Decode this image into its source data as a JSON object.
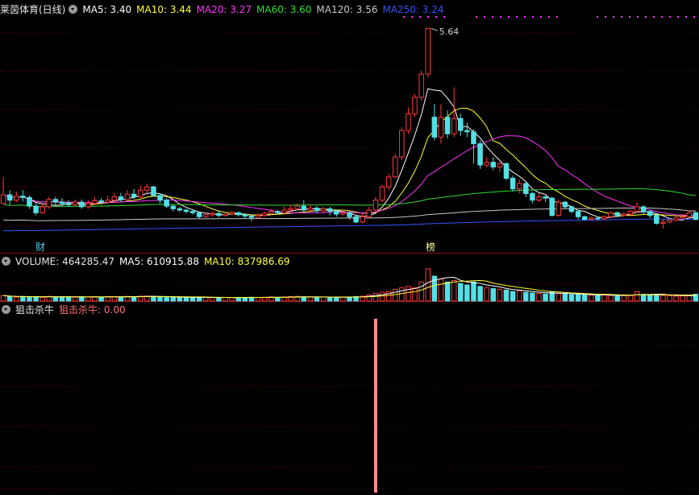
{
  "main_header": {
    "stock": "莱茵体育(日线)",
    "ma5_label": "MA5: 3.40",
    "ma10_label": "MA10: 3.44",
    "ma20_label": "MA20: 3.27",
    "ma60_label": "MA60: 3.60",
    "ma120_label": "MA120: 3.56",
    "ma250_label": "MA250: 3.24"
  },
  "peak_label": "5.64",
  "markers": {
    "cai": "财",
    "bang": "榜"
  },
  "volume_header": {
    "label": "VOLUME: 464285.47",
    "ma5": "MA5: 610915.88",
    "ma10": "MA10: 837986.69"
  },
  "indicator_header": {
    "name": "狙击杀牛",
    "value_label": "狙击杀牛: 0.00"
  },
  "colors": {
    "up": "#ff3a3a",
    "down": "#52e0e6",
    "ma5": "#ffffff",
    "ma10": "#ffff33",
    "ma20": "#ff33ff",
    "ma60": "#33dd33",
    "ma120": "#c8c8c8",
    "ma250": "#3355ff",
    "signal": "#ff8c8c"
  },
  "chart_data": {
    "type": "candlestick",
    "price_axis_range": [
      2.5,
      5.8
    ],
    "volume_axis_range": [
      0,
      2200000
    ],
    "indicator_axis_range": [
      0,
      1
    ],
    "signal_index": 57,
    "candles": [
      [
        3.0,
        3.13,
        3.4,
        3.0
      ],
      [
        3.13,
        3.05,
        3.2,
        2.98
      ],
      [
        3.05,
        3.11,
        3.18,
        3.02
      ],
      [
        3.11,
        3.09,
        3.2,
        3.03
      ],
      [
        3.09,
        2.96,
        3.12,
        2.92
      ],
      [
        2.96,
        2.86,
        3.0,
        2.82
      ],
      [
        2.86,
        2.95,
        3.0,
        2.84
      ],
      [
        2.95,
        3.06,
        3.1,
        2.92
      ],
      [
        3.06,
        3.02,
        3.1,
        2.98
      ],
      [
        3.02,
        3.0,
        3.08,
        2.96
      ],
      [
        3.0,
        2.98,
        3.05,
        2.95
      ],
      [
        2.98,
        3.02,
        3.06,
        2.95
      ],
      [
        3.02,
        2.95,
        3.06,
        2.92
      ],
      [
        2.95,
        3.0,
        3.05,
        2.92
      ],
      [
        3.0,
        3.04,
        3.1,
        2.98
      ],
      [
        3.04,
        3.02,
        3.08,
        2.98
      ],
      [
        3.02,
        3.05,
        3.12,
        3.0
      ],
      [
        3.05,
        3.1,
        3.15,
        3.02
      ],
      [
        3.1,
        3.06,
        3.16,
        3.03
      ],
      [
        3.06,
        3.14,
        3.2,
        3.04
      ],
      [
        3.14,
        3.1,
        3.22,
        3.07
      ],
      [
        3.1,
        3.2,
        3.27,
        3.08
      ],
      [
        3.2,
        3.25,
        3.3,
        3.15
      ],
      [
        3.25,
        3.12,
        3.27,
        3.1
      ],
      [
        3.12,
        3.05,
        3.15,
        3.0
      ],
      [
        3.05,
        2.96,
        3.08,
        2.93
      ],
      [
        2.96,
        2.92,
        2.98,
        2.88
      ],
      [
        2.92,
        2.9,
        2.95,
        2.87
      ],
      [
        2.9,
        2.88,
        2.92,
        2.85
      ],
      [
        2.88,
        2.86,
        2.9,
        2.83
      ],
      [
        2.86,
        2.8,
        2.88,
        2.77
      ],
      [
        2.8,
        2.83,
        2.86,
        2.78
      ],
      [
        2.83,
        2.85,
        2.88,
        2.8
      ],
      [
        2.85,
        2.82,
        2.88,
        2.79
      ],
      [
        2.82,
        2.84,
        2.87,
        2.8
      ],
      [
        2.84,
        2.86,
        2.89,
        2.82
      ],
      [
        2.86,
        2.83,
        2.88,
        2.8
      ],
      [
        2.83,
        2.81,
        2.86,
        2.78
      ],
      [
        2.81,
        2.79,
        2.83,
        2.73
      ],
      [
        2.79,
        2.82,
        2.85,
        2.77
      ],
      [
        2.82,
        2.85,
        2.88,
        2.8
      ],
      [
        2.85,
        2.88,
        2.92,
        2.82
      ],
      [
        2.88,
        2.86,
        2.9,
        2.83
      ],
      [
        2.86,
        2.9,
        2.95,
        2.84
      ],
      [
        2.9,
        2.92,
        2.98,
        2.88
      ],
      [
        2.92,
        2.96,
        3.0,
        2.9
      ],
      [
        2.96,
        2.9,
        3.05,
        2.87
      ],
      [
        2.9,
        2.93,
        2.98,
        2.88
      ],
      [
        2.93,
        2.89,
        2.96,
        2.85
      ],
      [
        2.89,
        2.92,
        2.95,
        2.85
      ],
      [
        2.92,
        2.88,
        2.95,
        2.82
      ],
      [
        2.88,
        2.84,
        2.91,
        2.8
      ],
      [
        2.84,
        2.86,
        2.9,
        2.82
      ],
      [
        2.86,
        2.8,
        2.88,
        2.76
      ],
      [
        2.8,
        2.72,
        2.82,
        2.7
      ],
      [
        2.72,
        2.8,
        2.85,
        2.7
      ],
      [
        2.8,
        2.9,
        2.95,
        2.78
      ],
      [
        2.9,
        3.05,
        3.1,
        2.88
      ],
      [
        3.05,
        3.25,
        3.28,
        3.02
      ],
      [
        3.25,
        3.4,
        3.45,
        3.2
      ],
      [
        3.4,
        3.7,
        3.75,
        3.38
      ],
      [
        3.7,
        4.1,
        4.15,
        3.65
      ],
      [
        4.1,
        4.35,
        4.45,
        4.05
      ],
      [
        4.35,
        4.6,
        4.65,
        4.3
      ],
      [
        4.6,
        4.95,
        5.0,
        4.55
      ],
      [
        4.95,
        5.64,
        5.64,
        4.9
      ],
      [
        4.3,
        4.0,
        4.5,
        3.95
      ],
      [
        4.0,
        4.3,
        4.5,
        3.9
      ],
      [
        4.3,
        4.05,
        4.4,
        3.98
      ],
      [
        4.05,
        4.28,
        4.75,
        4.0
      ],
      [
        4.28,
        4.1,
        4.35,
        4.02
      ],
      [
        4.1,
        4.08,
        4.22,
        4.0
      ],
      [
        4.08,
        3.9,
        4.12,
        3.6
      ],
      [
        3.9,
        3.58,
        3.95,
        3.52
      ],
      [
        3.58,
        3.62,
        3.7,
        3.55
      ],
      [
        3.62,
        3.55,
        3.7,
        3.5
      ],
      [
        3.55,
        3.6,
        3.65,
        3.48
      ],
      [
        3.6,
        3.38,
        3.62,
        3.35
      ],
      [
        3.38,
        3.22,
        3.42,
        3.18
      ],
      [
        3.22,
        3.3,
        3.36,
        3.15
      ],
      [
        3.3,
        3.15,
        3.32,
        3.1
      ],
      [
        3.15,
        3.05,
        3.18,
        3.0
      ],
      [
        3.05,
        3.1,
        3.15,
        3.02
      ],
      [
        3.1,
        3.08,
        3.12,
        3.02
      ],
      [
        3.08,
        2.82,
        3.1,
        2.8
      ],
      [
        2.82,
        3.02,
        3.06,
        2.8
      ],
      [
        3.02,
        2.95,
        3.04,
        2.92
      ],
      [
        2.95,
        2.88,
        2.97,
        2.85
      ],
      [
        2.88,
        2.8,
        2.9,
        2.76
      ],
      [
        2.8,
        2.76,
        2.82,
        2.74
      ],
      [
        2.76,
        2.78,
        2.8,
        2.74
      ],
      [
        2.78,
        2.77,
        2.8,
        2.74
      ],
      [
        2.77,
        2.8,
        2.82,
        2.75
      ],
      [
        2.8,
        2.86,
        2.88,
        2.78
      ],
      [
        2.86,
        2.82,
        2.88,
        2.79
      ],
      [
        2.82,
        2.84,
        2.87,
        2.8
      ],
      [
        2.84,
        2.88,
        2.9,
        2.82
      ],
      [
        2.88,
        2.95,
        3.02,
        2.86
      ],
      [
        2.95,
        2.88,
        2.97,
        2.84
      ],
      [
        2.88,
        2.82,
        2.9,
        2.78
      ],
      [
        2.82,
        2.7,
        2.84,
        2.68
      ],
      [
        2.7,
        2.72,
        2.76,
        2.62
      ],
      [
        2.72,
        2.75,
        2.78,
        2.7
      ],
      [
        2.75,
        2.78,
        2.82,
        2.73
      ],
      [
        2.78,
        2.8,
        2.84,
        2.76
      ],
      [
        2.8,
        2.86,
        2.9,
        2.78
      ],
      [
        2.86,
        2.76,
        2.88,
        2.74
      ]
    ],
    "volumes": [
      380000,
      300000,
      260000,
      300000,
      280000,
      300000,
      260000,
      320000,
      280000,
      270000,
      300000,
      260000,
      290000,
      280000,
      300000,
      270000,
      310000,
      300000,
      280000,
      320000,
      300000,
      330000,
      340000,
      310000,
      290000,
      260000,
      250000,
      270000,
      240000,
      250000,
      260000,
      250000,
      240000,
      230000,
      250000,
      240000,
      230000,
      250000,
      260000,
      250000,
      260000,
      280000,
      250000,
      270000,
      300000,
      320000,
      290000,
      280000,
      260000,
      270000,
      260000,
      250000,
      260000,
      280000,
      310000,
      330000,
      420000,
      520000,
      600000,
      650000,
      800000,
      900000,
      1000000,
      900000,
      1300000,
      2200000,
      1700000,
      1500000,
      1300000,
      1400000,
      1200000,
      1100000,
      1300000,
      1000000,
      900000,
      850000,
      800000,
      750000,
      650000,
      700000,
      600000,
      550000,
      520000,
      480000,
      600000,
      520000,
      480000,
      430000,
      460000,
      420000,
      400000,
      380000,
      420000,
      380000,
      400000,
      360000,
      380000,
      640000,
      450000,
      400000,
      460000,
      380000,
      360000,
      340000,
      350000,
      380000,
      464285
    ]
  }
}
